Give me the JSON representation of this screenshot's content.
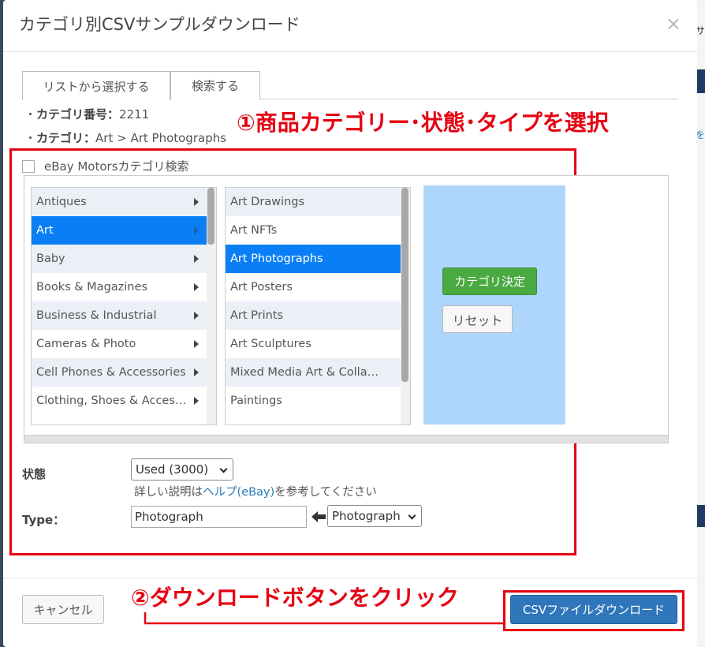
{
  "modal": {
    "title": "カテゴリ別CSVサンプルダウンロード",
    "close": "×"
  },
  "tabs": [
    {
      "label": "リストから選択する"
    },
    {
      "label": "検索する"
    }
  ],
  "info": {
    "cat_no_label": "カテゴリ番号：",
    "cat_no_value": "2211",
    "cat_label": "カテゴリ：",
    "cat_value": "Art > Art Photographs"
  },
  "annotations": {
    "step1": "①商品カテゴリー･状態･タイプを選択",
    "step2": "②ダウンロードボタンをクリック"
  },
  "motors_check": {
    "label": "eBay Motorsカテゴリ検索",
    "checked": false
  },
  "categories_l1": [
    {
      "label": "Antiques"
    },
    {
      "label": "Art"
    },
    {
      "label": "Baby"
    },
    {
      "label": "Books & Magazines"
    },
    {
      "label": "Business & Industrial"
    },
    {
      "label": "Cameras & Photo"
    },
    {
      "label": "Cell Phones & Accessories"
    },
    {
      "label": "Clothing, Shoes & Acces…"
    }
  ],
  "categories_l2": [
    {
      "label": "Art Drawings"
    },
    {
      "label": "Art NFTs"
    },
    {
      "label": "Art Photographs"
    },
    {
      "label": "Art Posters"
    },
    {
      "label": "Art Prints"
    },
    {
      "label": "Art Sculptures"
    },
    {
      "label": "Mixed Media Art & Colla…"
    },
    {
      "label": "Paintings"
    }
  ],
  "buttons": {
    "decide": "カテゴリ決定",
    "reset": "リセット",
    "cancel": "キャンセル",
    "csv": "CSVファイルダウンロード"
  },
  "condition": {
    "label": "状態",
    "selected": "Used (3000)",
    "help_before": "詳しい説明は",
    "help_link": "ヘルプ(eBay)",
    "help_after": "を参考してください"
  },
  "type": {
    "label": "Type：",
    "input_value": "Photograph",
    "selected": "Photograph"
  },
  "background": {
    "chars": [
      "サ",
      "を"
    ]
  },
  "colors": {
    "accent_red": "#e60012",
    "selected_blue": "#0a7ff5",
    "green_button": "#4aaa42",
    "primary_button": "#2f77ba"
  }
}
